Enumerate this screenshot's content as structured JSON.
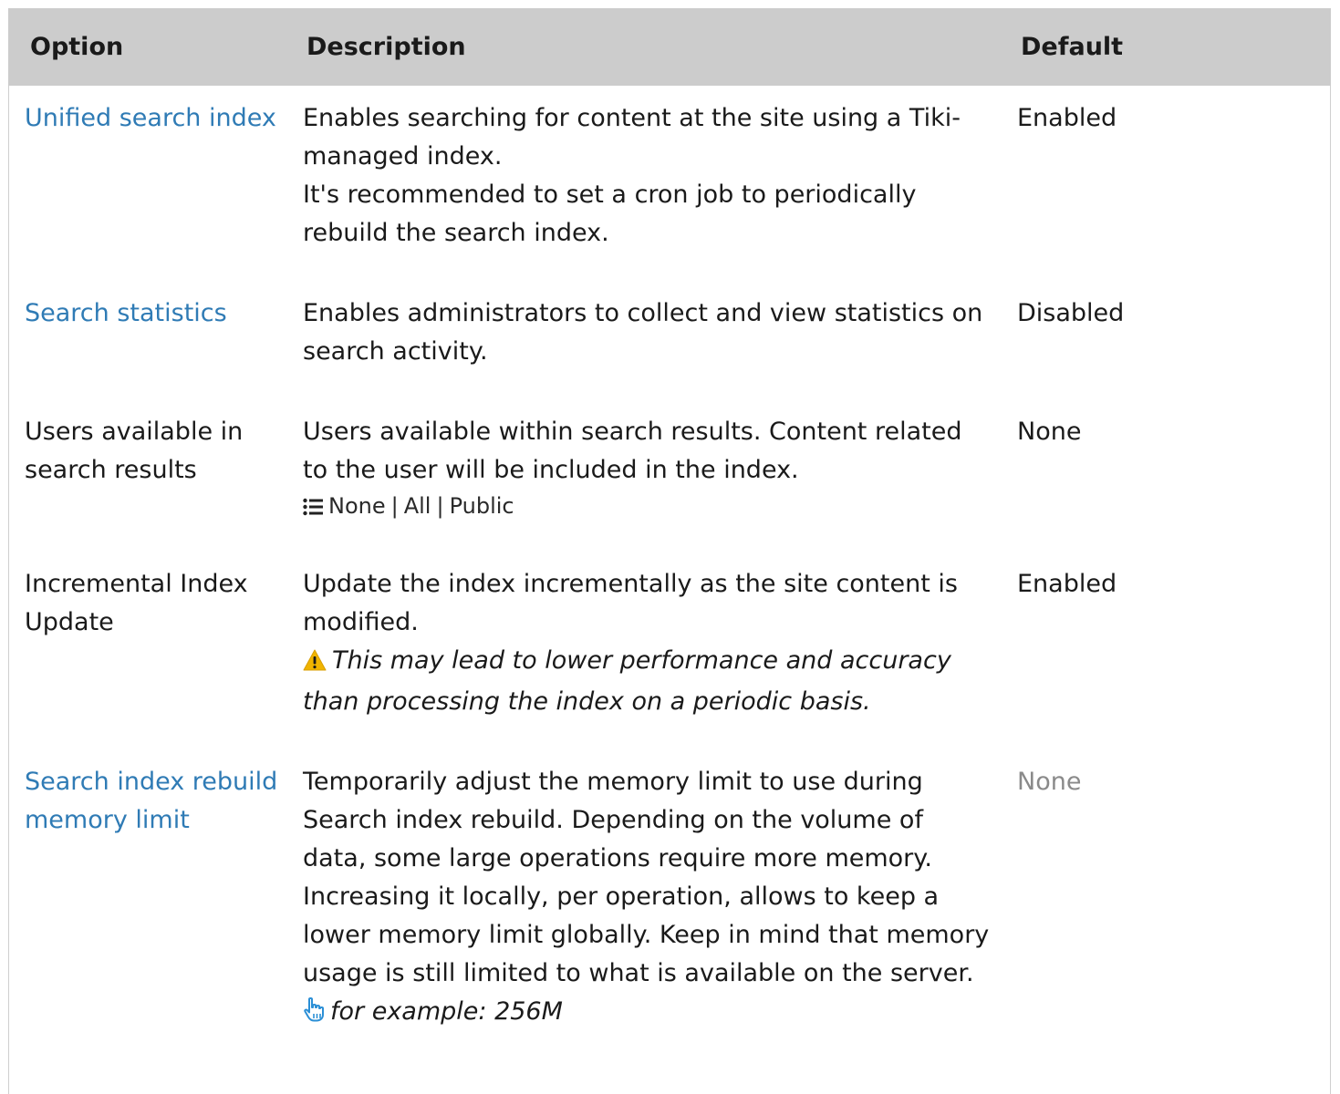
{
  "table": {
    "headers": {
      "option": "Option",
      "description": "Description",
      "default": "Default"
    },
    "rows": [
      {
        "option": "Unified search index",
        "option_is_link": true,
        "description_lines": [
          "Enables searching for content at the site using a Tiki-managed index.",
          "It's recommended to set a cron job to periodically rebuild the search index."
        ],
        "default": "Enabled"
      },
      {
        "option": "Search statistics",
        "option_is_link": true,
        "description_lines": [
          "Enables administrators to collect and view statistics on search activity."
        ],
        "default": "Disabled"
      },
      {
        "option": "Users available in search results",
        "option_is_link": false,
        "description_lines": [
          "Users available within search results. Content related to the user will be included in the index."
        ],
        "options_icon": "list-icon",
        "options": [
          "None",
          "All",
          "Public"
        ],
        "options_separator": "|",
        "default": "None"
      },
      {
        "option": "Incremental Index Update",
        "option_is_link": false,
        "description_lines": [
          "Update the index incrementally as the site content is modified."
        ],
        "warning_icon": "warning-icon",
        "warning": "This may lead to lower performance and accuracy than processing the index on a periodic basis.",
        "default": "Enabled"
      },
      {
        "option": "Search index rebuild memory limit",
        "option_is_link": true,
        "description_lines": [
          "Temporarily adjust the memory limit to use during Search index rebuild. Depending on the volume of data, some large operations require more memory. Increasing it locally, per operation, allows to keep a lower memory limit globally. Keep in mind that memory usage is still limited to what is available on the server."
        ],
        "example_icon": "pointing-hand-icon",
        "example": "for example: 256M",
        "default": "None",
        "default_muted": true
      }
    ]
  },
  "colors": {
    "header_bg": "#cccccc",
    "link": "#2f7bb5",
    "muted": "#8a8a8a",
    "warning": "#f0b400",
    "hand_icon": "#2b8fd6"
  }
}
